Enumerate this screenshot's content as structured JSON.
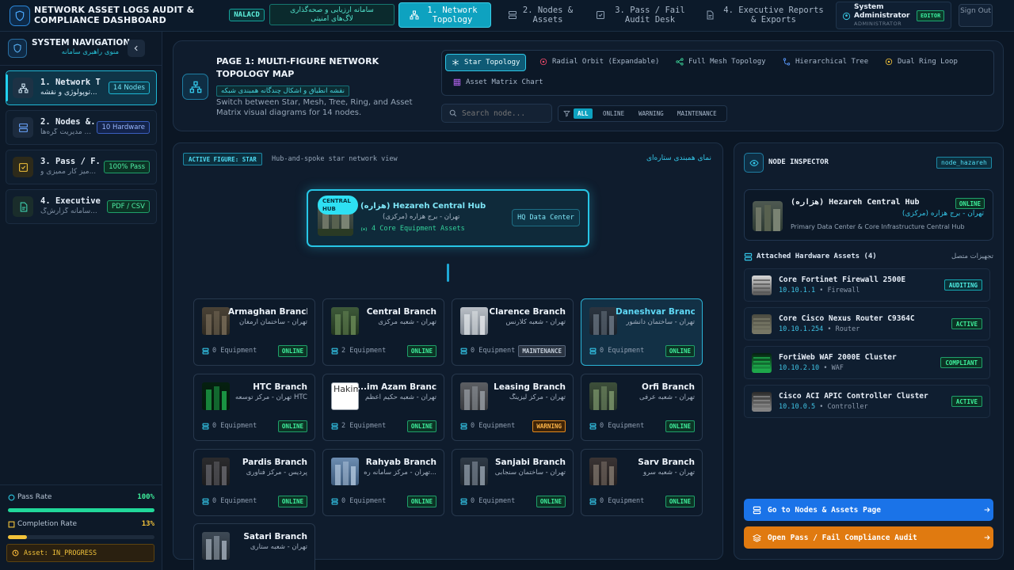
{
  "app": {
    "title": "NETWORK ASSET LOGS AUDIT & COMPLIANCE DASHBOARD",
    "org_badge": "NALACD",
    "fa_badge_line1": "سامانه ارزیابی و صحه‌گذاری",
    "fa_badge_line2": "لاگ‌های امنیتی"
  },
  "tabs": [
    {
      "label": "1. Network Topology",
      "icon": "topology-icon",
      "active": true
    },
    {
      "label": "2. Nodes & Assets",
      "icon": "server-icon",
      "active": false
    },
    {
      "label": "3. Pass / Fail Audit Desk",
      "icon": "checkbox-icon",
      "active": false
    },
    {
      "label": "4. Executive Reports & Exports",
      "icon": "document-icon",
      "active": false
    }
  ],
  "user": {
    "name": "System Administrator",
    "role": "ADMINISTRATOR",
    "badge": "EDITOR",
    "signout": "Sign Out"
  },
  "sidebar": {
    "title": "SYSTEM NAVIGATION",
    "subtitle": "منوی راهبری سامانه",
    "items": [
      {
        "label": "1. Network T...",
        "sub": "توپولوژی و نقشه...",
        "pill": "14 Nodes",
        "active": true
      },
      {
        "label": "2. Nodes &...",
        "sub": "مدیریت گره‌ها ...",
        "pill": "10 Hardware",
        "active": false
      },
      {
        "label": "3. Pass / F...",
        "sub": "میز کار ممیزی و...",
        "pill": "100% Pass",
        "active": false
      },
      {
        "label": "4. Executive...",
        "sub": "سامانه گزارش‌گ...",
        "pill": "PDF / CSV",
        "active": false
      }
    ],
    "stats": {
      "pass_label": "Pass Rate",
      "pass_value": "100%",
      "pass_fraction": 1.0,
      "completion_label": "Completion Rate",
      "completion_value": "13%",
      "completion_fraction": 0.13,
      "asset_status": "Asset: IN_PROGRESS"
    }
  },
  "header": {
    "title": "PAGE 1: MULTI-FIGURE NETWORK TOPOLOGY MAP",
    "fa_subtitle": "نقشه انطباق و اشکال چندگانه همبندی شبکه",
    "description": "Switch between Star, Mesh, Tree, Ring, and Asset Matrix visual diagrams for 14 nodes.",
    "figures": [
      {
        "label": "Star Topology",
        "icon": "star-topology-icon",
        "active": true
      },
      {
        "label": "Radial Orbit (Expandable)",
        "icon": "radial-orbit-icon",
        "active": false
      },
      {
        "label": "Full Mesh Topology",
        "icon": "mesh-icon",
        "active": false
      },
      {
        "label": "Hierarchical Tree",
        "icon": "tree-icon",
        "active": false
      },
      {
        "label": "Dual Ring Loop",
        "icon": "ring-icon",
        "active": false
      },
      {
        "label": "Asset Matrix Chart",
        "icon": "matrix-icon",
        "active": false
      }
    ],
    "search_placeholder": "Search node...",
    "filters": [
      "ALL",
      "ONLINE",
      "WARNING",
      "MAINTENANCE"
    ]
  },
  "figure": {
    "badge": "ACTIVE FIGURE: STAR",
    "description": "Hub-and-spoke star network view",
    "fa_title": "نمای همبندی ستاره‌ای",
    "hub": {
      "tag": "CENTRAL HUB",
      "name": "(هزاره) Hezareh Central Hub",
      "sub": "تهران - برج هزاره (مرکزی)",
      "assets": "4 Core Equipment Assets",
      "button": "HQ Data Center"
    },
    "branches": [
      {
        "name": "Armaghan Branch",
        "sub": "تهران - ساختمان ارمغان",
        "equip": "0 Equipment",
        "status": "ONLINE"
      },
      {
        "name": "Central Branch",
        "sub": "تهران - شعبه مرکزی",
        "equip": "2 Equipment",
        "status": "ONLINE"
      },
      {
        "name": "Clarence Branch",
        "sub": "تهران - شعبه کلارنس",
        "equip": "0 Equipment",
        "status": "MAINTENANCE"
      },
      {
        "name": "Daneshvar Branch",
        "sub": "تهران - ساختمان دانشور",
        "equip": "0 Equipment",
        "status": "ONLINE"
      },
      {
        "name": "HTC Branch",
        "sub": "تهران - مرکز توسعه HTC",
        "equip": "0 Equipment",
        "status": "ONLINE"
      },
      {
        "name": "...im Azam Branch",
        "sub": "تهران - شعبه حکیم اعظم",
        "equip": "2 Equipment",
        "status": "ONLINE",
        "alt": "Hakim"
      },
      {
        "name": "Leasing Branch",
        "sub": "تهران - مرکز لیزینگ",
        "equip": "0 Equipment",
        "status": "WARNING"
      },
      {
        "name": "Orfi Branch",
        "sub": "تهران - شعبه عرفی",
        "equip": "0 Equipment",
        "status": "ONLINE"
      },
      {
        "name": "Pardis Branch",
        "sub": "پردیس - مرکز فناوری",
        "equip": "0 Equipment",
        "status": "ONLINE"
      },
      {
        "name": "Rahyab Branch",
        "sub": "تهران - مرکز سامانه ره...",
        "equip": "0 Equipment",
        "status": "ONLINE"
      },
      {
        "name": "Sanjabi Branch",
        "sub": "تهران - ساختمان سنجابی",
        "equip": "0 Equipment",
        "status": "ONLINE"
      },
      {
        "name": "Sarv Branch",
        "sub": "تهران - شعبه سرو",
        "equip": "0 Equipment",
        "status": "ONLINE"
      },
      {
        "name": "Satari Branch",
        "sub": "تهران - شعبه ستاری",
        "equip": "",
        "status": ""
      }
    ]
  },
  "inspector": {
    "title": "NODE INSPECTOR",
    "node_id": "node_hazareh",
    "node": {
      "name": "(هزاره) Hezareh Central Hub",
      "fa": "تهران - برج هزاره (مرکزی)",
      "desc": "Primary Data Center & Core Infrastructure Central Hub",
      "status": "ONLINE"
    },
    "assets_title": "Attached Hardware Assets (4)",
    "assets_fa": "تجهیزات متصل",
    "assets": [
      {
        "name": "Core Fortinet Firewall 2500E",
        "ip": "10.10.1.1",
        "type": "Firewall",
        "status": "AUDITING"
      },
      {
        "name": "Core Cisco Nexus Router C9364C",
        "ip": "10.10.1.254",
        "type": "Router",
        "status": "ACTIVE"
      },
      {
        "name": "FortiWeb WAF 2000E Cluster",
        "ip": "10.10.2.10",
        "type": "WAF",
        "status": "COMPLIANT"
      },
      {
        "name": "Cisco ACI APIC Controller Cluster",
        "ip": "10.10.0.5",
        "type": "Controller",
        "status": "ACTIVE"
      }
    ],
    "btn_nodes": "Go to Nodes & Assets Page",
    "btn_audit": "Open Pass / Fail Compliance Audit"
  }
}
